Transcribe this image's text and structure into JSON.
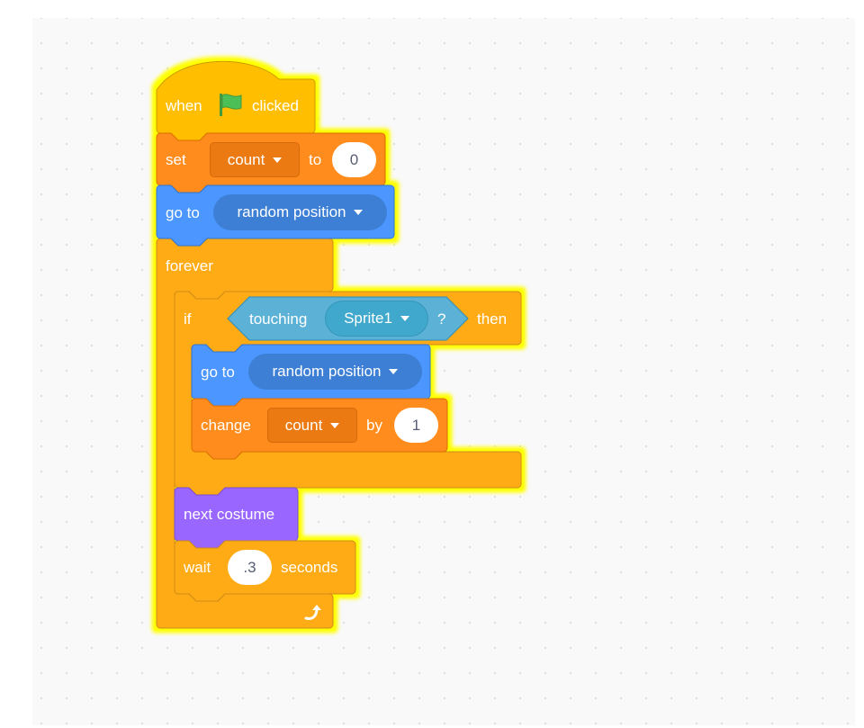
{
  "workspace": {
    "grid": "dotted",
    "colors": {
      "events": "#ffbf00",
      "control": "#ffab19",
      "variables": "#ff8c1a",
      "motion": "#4c97ff",
      "sensing": "#5cb1d6",
      "looks": "#9966ff",
      "glow": "#ffff00"
    }
  },
  "script": {
    "hat": {
      "when": "when",
      "icon": "green-flag-icon",
      "clicked": "clicked"
    },
    "set": {
      "label": "set",
      "variable": "count",
      "to": "to",
      "value": "0"
    },
    "goto1": {
      "label": "go to",
      "target": "random position"
    },
    "forever": {
      "label": "forever",
      "icon": "loop-arrow-icon"
    },
    "if": {
      "label": "if",
      "then": "then",
      "condition": {
        "label": "touching",
        "object": "Sprite1",
        "question": "?"
      }
    },
    "goto2": {
      "label": "go to",
      "target": "random position"
    },
    "change": {
      "label": "change",
      "variable": "count",
      "by": "by",
      "value": "1"
    },
    "next_costume": {
      "label": "next costume"
    },
    "wait": {
      "label": "wait",
      "value": ".3",
      "unit": "seconds"
    }
  }
}
